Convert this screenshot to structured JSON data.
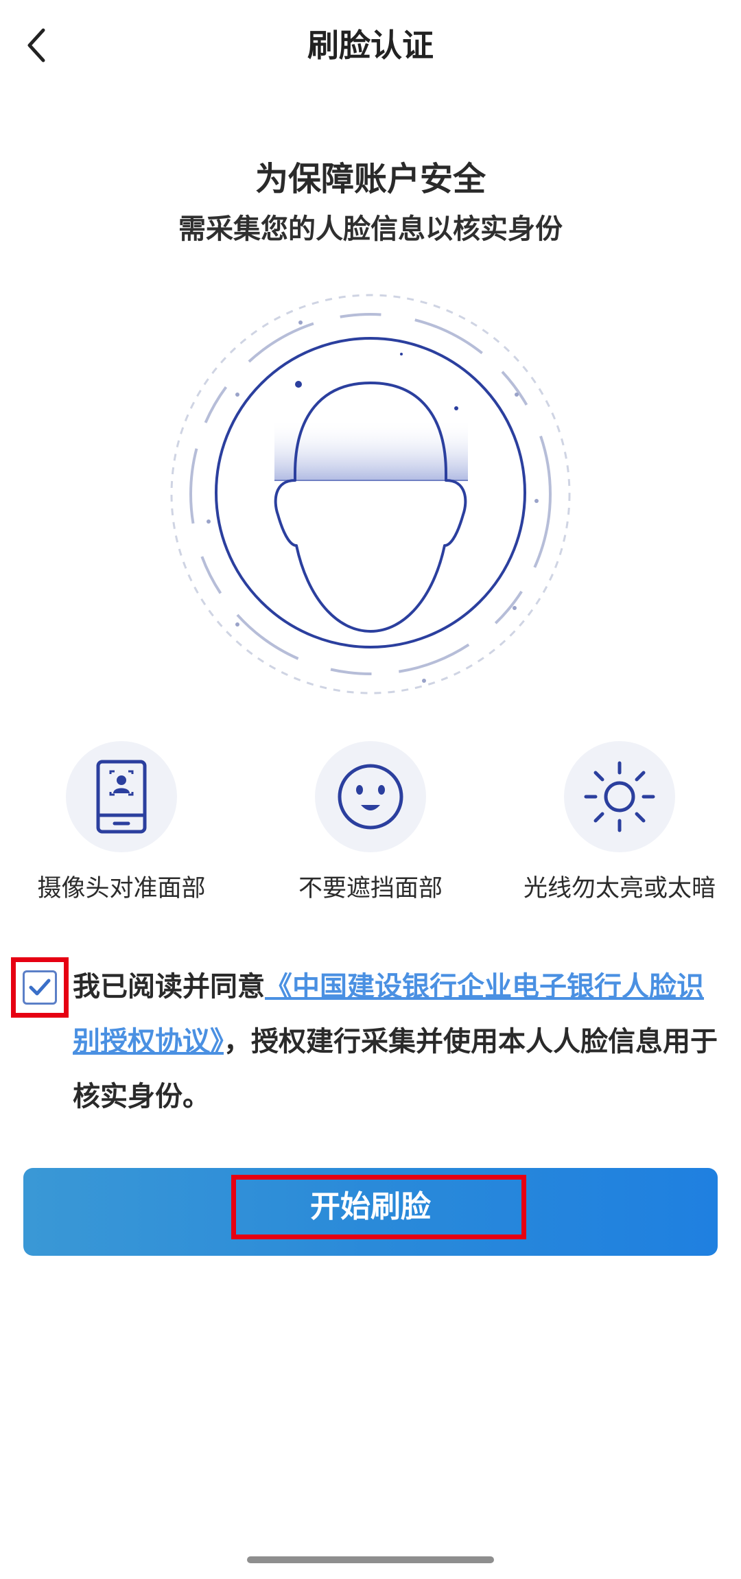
{
  "nav": {
    "title": "刷脸认证",
    "back_icon": "chevron-left-icon"
  },
  "intro": {
    "headline": "为保障账户安全",
    "subline": "需采集您的人脸信息以核实身份"
  },
  "illustration": {
    "icon": "face-scan-icon",
    "accent_color": "#2b3f9e"
  },
  "tips": [
    {
      "icon": "phone-camera-icon",
      "label": "摄像头对准面部"
    },
    {
      "icon": "smile-face-icon",
      "label": "不要遮挡面部"
    },
    {
      "icon": "sun-icon",
      "label": "光线勿太亮或太暗"
    }
  ],
  "consent": {
    "checked": true,
    "prefix": "我已阅读并同意",
    "link_text": "《中国建设银行企业电子银行人脸识别授权协议》",
    "suffix": "，授权建行采集并使用本人人脸信息用于核实身份。",
    "link_color": "#4a90e2"
  },
  "start_button": {
    "label": "开始刷脸",
    "color": "#2a8ad9"
  },
  "highlight_color": "#e60012"
}
